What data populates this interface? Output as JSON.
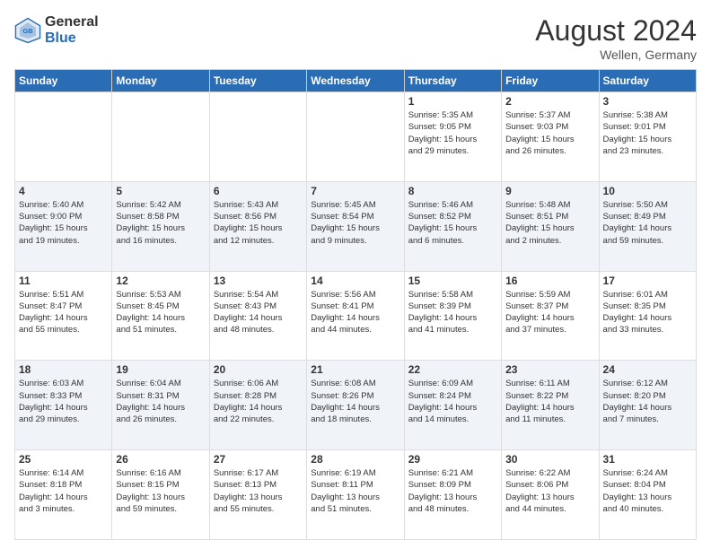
{
  "header": {
    "logo_line1": "General",
    "logo_line2": "Blue",
    "month_title": "August 2024",
    "location": "Wellen, Germany"
  },
  "weekdays": [
    "Sunday",
    "Monday",
    "Tuesday",
    "Wednesday",
    "Thursday",
    "Friday",
    "Saturday"
  ],
  "weeks": [
    [
      {
        "day": "",
        "info": ""
      },
      {
        "day": "",
        "info": ""
      },
      {
        "day": "",
        "info": ""
      },
      {
        "day": "",
        "info": ""
      },
      {
        "day": "1",
        "info": "Sunrise: 5:35 AM\nSunset: 9:05 PM\nDaylight: 15 hours\nand 29 minutes."
      },
      {
        "day": "2",
        "info": "Sunrise: 5:37 AM\nSunset: 9:03 PM\nDaylight: 15 hours\nand 26 minutes."
      },
      {
        "day": "3",
        "info": "Sunrise: 5:38 AM\nSunset: 9:01 PM\nDaylight: 15 hours\nand 23 minutes."
      }
    ],
    [
      {
        "day": "4",
        "info": "Sunrise: 5:40 AM\nSunset: 9:00 PM\nDaylight: 15 hours\nand 19 minutes."
      },
      {
        "day": "5",
        "info": "Sunrise: 5:42 AM\nSunset: 8:58 PM\nDaylight: 15 hours\nand 16 minutes."
      },
      {
        "day": "6",
        "info": "Sunrise: 5:43 AM\nSunset: 8:56 PM\nDaylight: 15 hours\nand 12 minutes."
      },
      {
        "day": "7",
        "info": "Sunrise: 5:45 AM\nSunset: 8:54 PM\nDaylight: 15 hours\nand 9 minutes."
      },
      {
        "day": "8",
        "info": "Sunrise: 5:46 AM\nSunset: 8:52 PM\nDaylight: 15 hours\nand 6 minutes."
      },
      {
        "day": "9",
        "info": "Sunrise: 5:48 AM\nSunset: 8:51 PM\nDaylight: 15 hours\nand 2 minutes."
      },
      {
        "day": "10",
        "info": "Sunrise: 5:50 AM\nSunset: 8:49 PM\nDaylight: 14 hours\nand 59 minutes."
      }
    ],
    [
      {
        "day": "11",
        "info": "Sunrise: 5:51 AM\nSunset: 8:47 PM\nDaylight: 14 hours\nand 55 minutes."
      },
      {
        "day": "12",
        "info": "Sunrise: 5:53 AM\nSunset: 8:45 PM\nDaylight: 14 hours\nand 51 minutes."
      },
      {
        "day": "13",
        "info": "Sunrise: 5:54 AM\nSunset: 8:43 PM\nDaylight: 14 hours\nand 48 minutes."
      },
      {
        "day": "14",
        "info": "Sunrise: 5:56 AM\nSunset: 8:41 PM\nDaylight: 14 hours\nand 44 minutes."
      },
      {
        "day": "15",
        "info": "Sunrise: 5:58 AM\nSunset: 8:39 PM\nDaylight: 14 hours\nand 41 minutes."
      },
      {
        "day": "16",
        "info": "Sunrise: 5:59 AM\nSunset: 8:37 PM\nDaylight: 14 hours\nand 37 minutes."
      },
      {
        "day": "17",
        "info": "Sunrise: 6:01 AM\nSunset: 8:35 PM\nDaylight: 14 hours\nand 33 minutes."
      }
    ],
    [
      {
        "day": "18",
        "info": "Sunrise: 6:03 AM\nSunset: 8:33 PM\nDaylight: 14 hours\nand 29 minutes."
      },
      {
        "day": "19",
        "info": "Sunrise: 6:04 AM\nSunset: 8:31 PM\nDaylight: 14 hours\nand 26 minutes."
      },
      {
        "day": "20",
        "info": "Sunrise: 6:06 AM\nSunset: 8:28 PM\nDaylight: 14 hours\nand 22 minutes."
      },
      {
        "day": "21",
        "info": "Sunrise: 6:08 AM\nSunset: 8:26 PM\nDaylight: 14 hours\nand 18 minutes."
      },
      {
        "day": "22",
        "info": "Sunrise: 6:09 AM\nSunset: 8:24 PM\nDaylight: 14 hours\nand 14 minutes."
      },
      {
        "day": "23",
        "info": "Sunrise: 6:11 AM\nSunset: 8:22 PM\nDaylight: 14 hours\nand 11 minutes."
      },
      {
        "day": "24",
        "info": "Sunrise: 6:12 AM\nSunset: 8:20 PM\nDaylight: 14 hours\nand 7 minutes."
      }
    ],
    [
      {
        "day": "25",
        "info": "Sunrise: 6:14 AM\nSunset: 8:18 PM\nDaylight: 14 hours\nand 3 minutes."
      },
      {
        "day": "26",
        "info": "Sunrise: 6:16 AM\nSunset: 8:15 PM\nDaylight: 13 hours\nand 59 minutes."
      },
      {
        "day": "27",
        "info": "Sunrise: 6:17 AM\nSunset: 8:13 PM\nDaylight: 13 hours\nand 55 minutes."
      },
      {
        "day": "28",
        "info": "Sunrise: 6:19 AM\nSunset: 8:11 PM\nDaylight: 13 hours\nand 51 minutes."
      },
      {
        "day": "29",
        "info": "Sunrise: 6:21 AM\nSunset: 8:09 PM\nDaylight: 13 hours\nand 48 minutes."
      },
      {
        "day": "30",
        "info": "Sunrise: 6:22 AM\nSunset: 8:06 PM\nDaylight: 13 hours\nand 44 minutes."
      },
      {
        "day": "31",
        "info": "Sunrise: 6:24 AM\nSunset: 8:04 PM\nDaylight: 13 hours\nand 40 minutes."
      }
    ]
  ]
}
